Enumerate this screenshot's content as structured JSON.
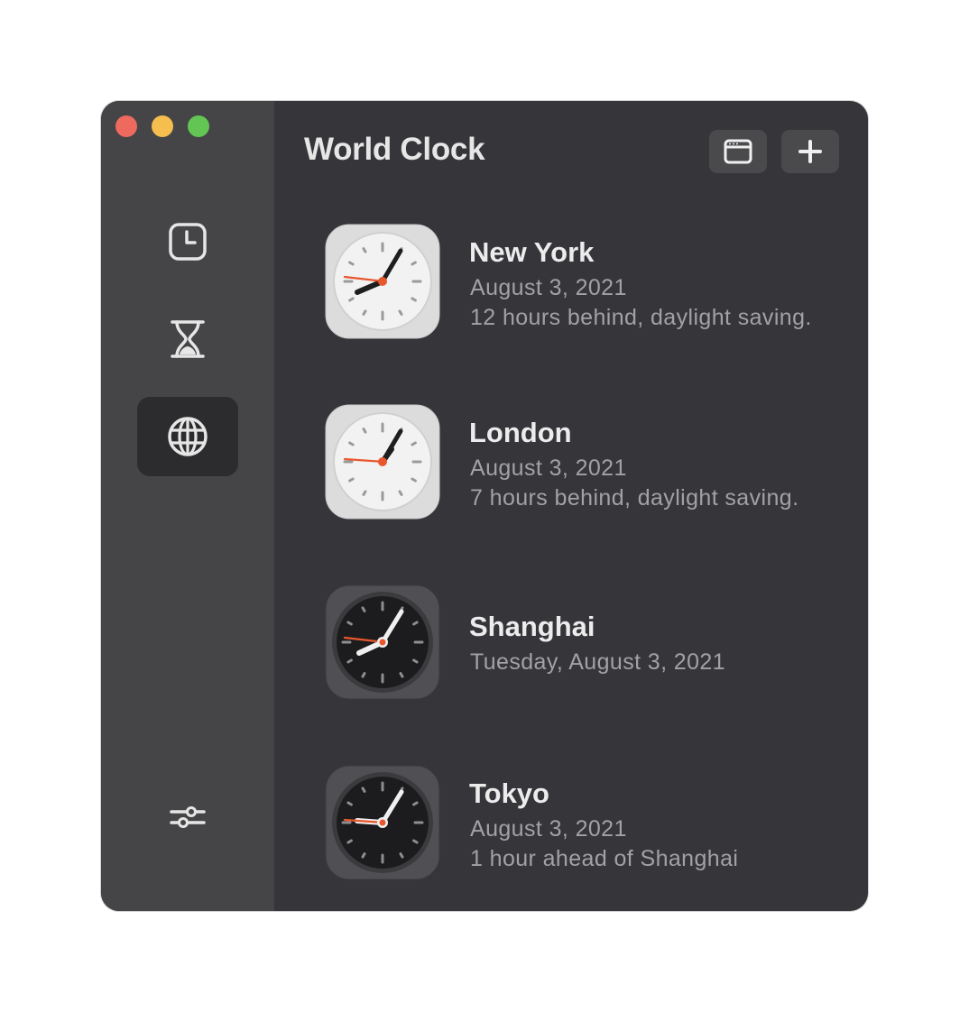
{
  "window": {
    "title": "World Clock",
    "traffic_lights": {
      "close": "#ee6a5f",
      "minimize": "#f5be4f",
      "maximize": "#62c554"
    }
  },
  "sidebar": {
    "items": [
      {
        "name": "clock",
        "icon": "clock-icon",
        "active": false
      },
      {
        "name": "timer",
        "icon": "hourglass-icon",
        "active": false
      },
      {
        "name": "world-clock",
        "icon": "globe-icon",
        "active": true
      }
    ],
    "footer_icon": "sliders-icon"
  },
  "toolbar": {
    "window_icon": "window-icon",
    "add_icon": "plus-icon"
  },
  "clocks": [
    {
      "city": "New York",
      "date": "August 3, 2021",
      "offset": "12 hours behind, daylight saving.",
      "face": "light"
    },
    {
      "city": "London",
      "date": "August 3, 2021",
      "offset": "7 hours behind, daylight saving.",
      "face": "light"
    },
    {
      "city": "Shanghai",
      "date": "Tuesday, August 3, 2021",
      "offset": "",
      "face": "dark"
    },
    {
      "city": "Tokyo",
      "date": "August 3, 2021",
      "offset": "1 hour ahead of Shanghai",
      "face": "dark"
    }
  ],
  "colors": {
    "accent_second_hand": "#e8572e",
    "window_bg": "#36353a",
    "sidebar_bg": "#454547"
  }
}
